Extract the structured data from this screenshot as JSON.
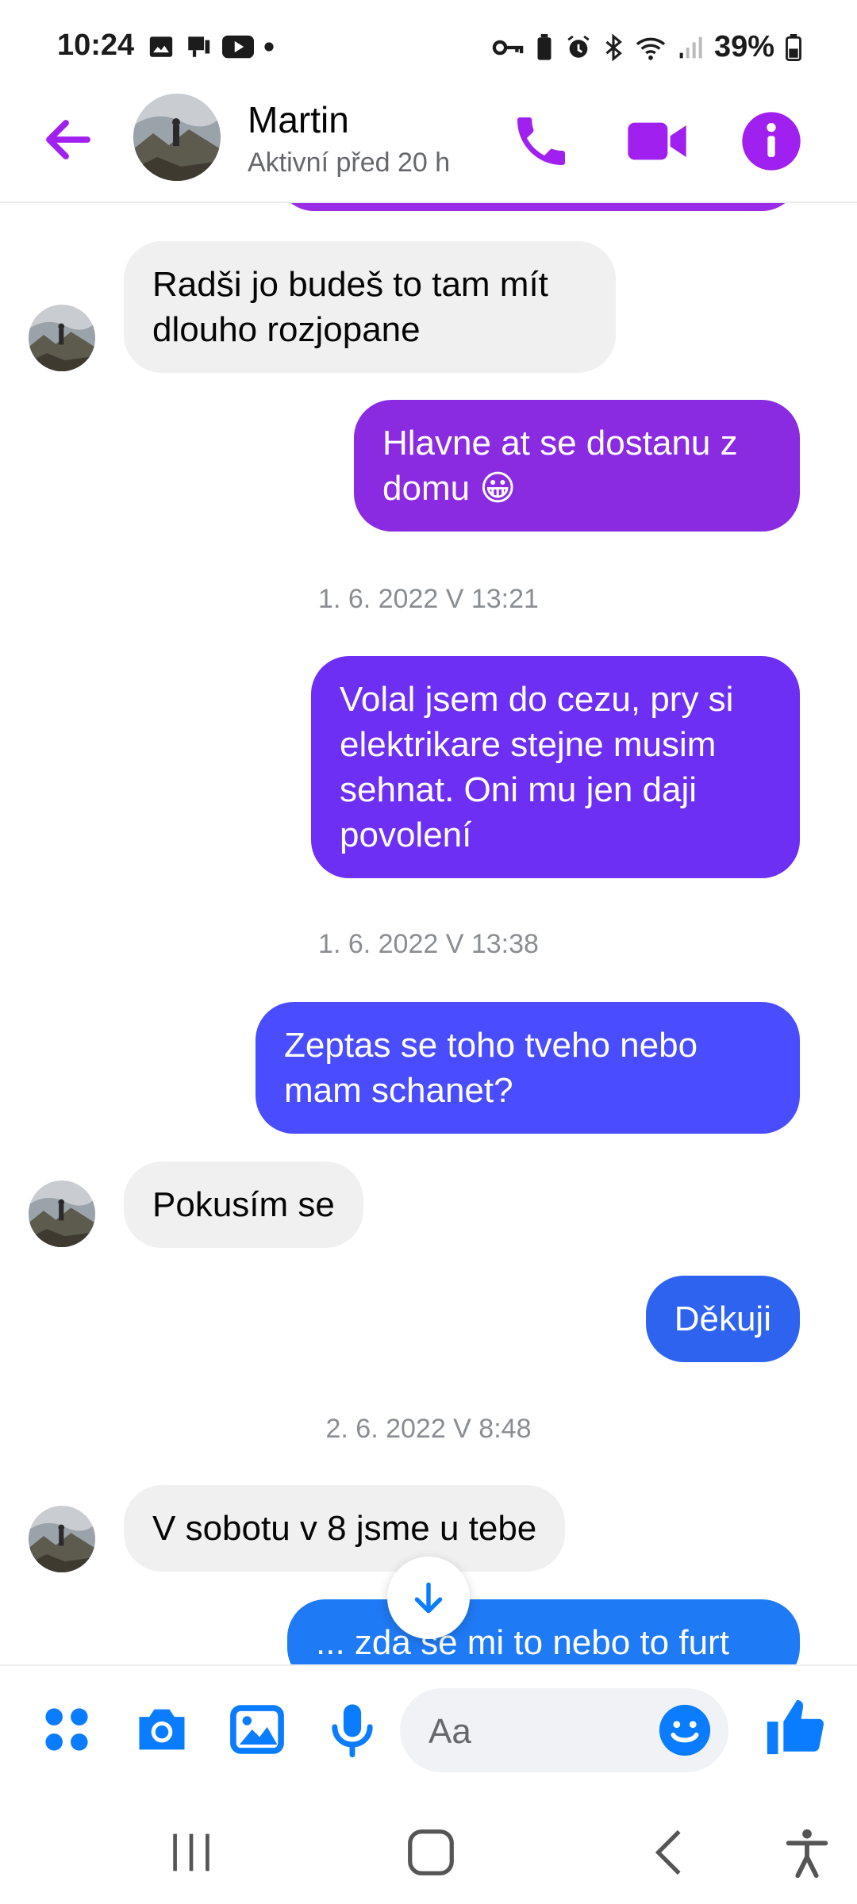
{
  "status_bar": {
    "time": "10:24",
    "battery": "39%"
  },
  "header": {
    "name": "Martin",
    "status": "Aktivní před 20 h"
  },
  "messages": [
    {
      "direction": "in",
      "text": "Radši jo budeš to tam mít dlouho rozjopane"
    },
    {
      "direction": "out",
      "text": "Hlavne at se dostanu z domu 😀",
      "color": "#8a2be2"
    },
    {
      "type": "timestamp",
      "text": "1. 6. 2022 V 13:21"
    },
    {
      "direction": "out",
      "text": "Volal jsem do cezu, pry si elektrikare stejne musim sehnat. Oni mu jen daji povolení",
      "color": "#6e2ff5"
    },
    {
      "type": "timestamp",
      "text": "1. 6. 2022 V 13:38"
    },
    {
      "direction": "out",
      "text": "Zeptas se toho tveho nebo mam schanet?",
      "color": "#4a4cff"
    },
    {
      "direction": "in",
      "text": "Pokusím se"
    },
    {
      "direction": "out",
      "text": "Děkuji",
      "color": "#2e63f0"
    },
    {
      "type": "timestamp",
      "text": "2. 6. 2022 V 8:48"
    },
    {
      "direction": "in",
      "text": "V sobotu v 8 jsme u tebe"
    },
    {
      "direction": "out",
      "text": "... zda se mi to nebo to furt",
      "color": "#1f7af5"
    }
  ],
  "composer": {
    "placeholder": "Aa"
  },
  "colors": {
    "accent_header": "#a020f0",
    "accent_composer": "#0a7cff"
  },
  "icons": {
    "header": [
      "back-arrow-icon",
      "phone-icon",
      "video-camera-icon",
      "info-icon"
    ],
    "composer": [
      "menu-dots-icon",
      "camera-icon",
      "image-icon",
      "microphone-icon",
      "emoji-icon",
      "thumbs-up-icon"
    ],
    "navbar": [
      "recent-apps-icon",
      "home-icon",
      "back-icon",
      "accessibility-icon"
    ]
  }
}
